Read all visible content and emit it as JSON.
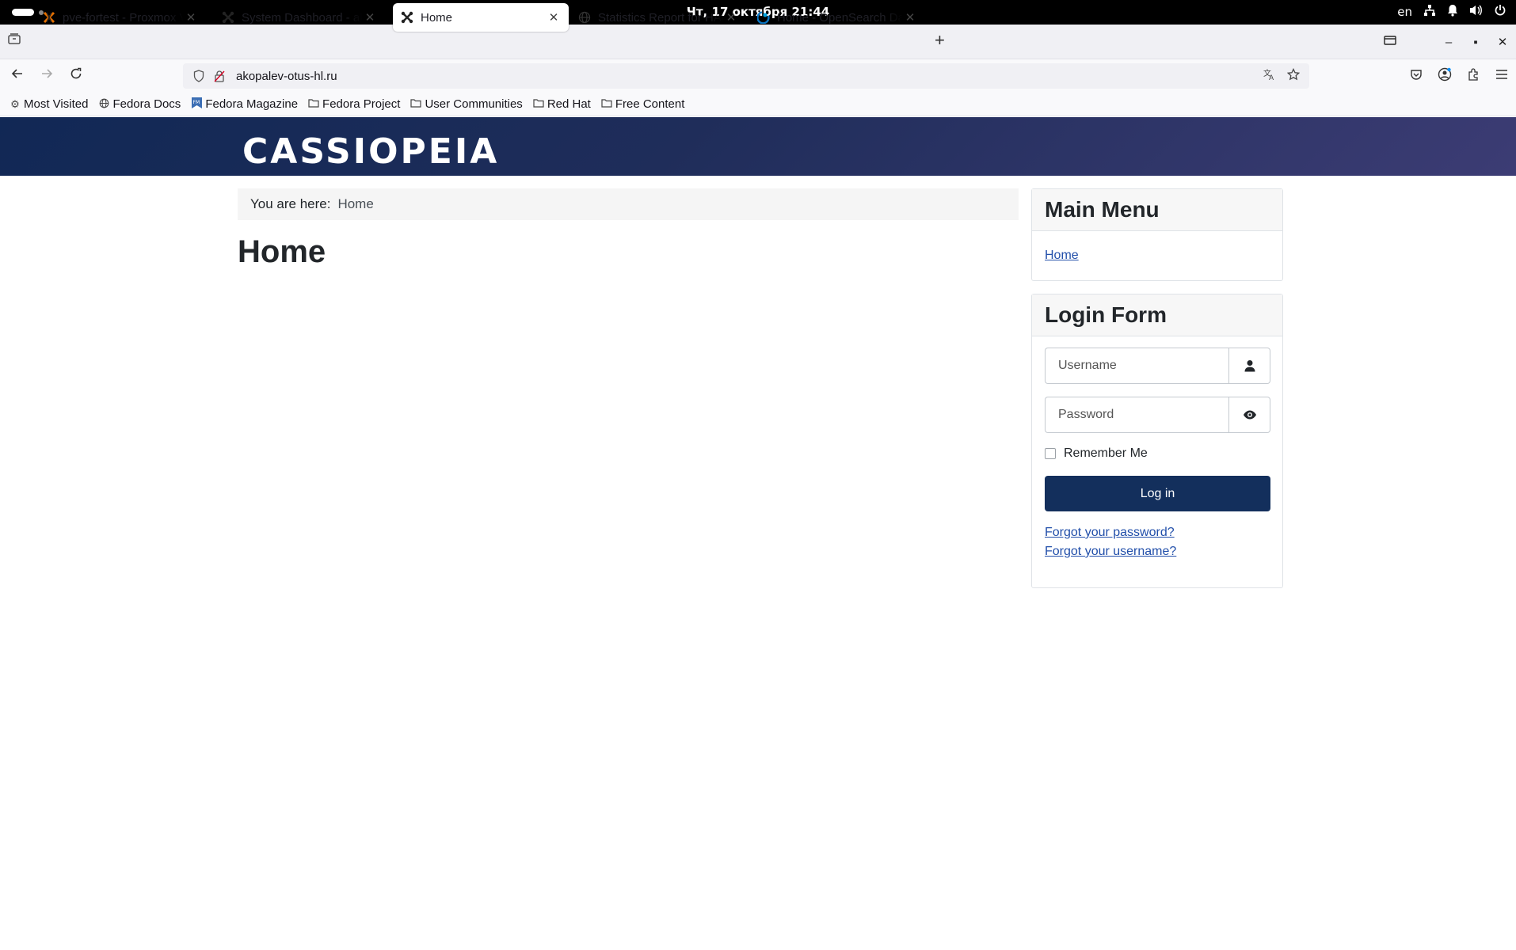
{
  "system": {
    "clock": "Чт, 17 октября  21:44",
    "lang": "en"
  },
  "browser": {
    "tabs": [
      {
        "title": "pve-fortest - Proxmox Virtual Environment",
        "icon": "proxmox-icon"
      },
      {
        "title": "System Dashboard - akopalev-otus-hl.ru",
        "icon": "joomla-icon"
      },
      {
        "title": "Home",
        "icon": "joomla-icon"
      },
      {
        "title": "Statistics Report for HAProxy",
        "icon": "globe-icon"
      },
      {
        "title": "Home - OpenSearch Dashboards",
        "icon": "opensearch-icon"
      }
    ],
    "url": "akopalev-otus-hl.ru",
    "bookmarks": [
      {
        "label": "Most Visited",
        "icon": "gear-icon"
      },
      {
        "label": "Fedora Docs",
        "icon": "globe-icon"
      },
      {
        "label": "Fedora Magazine",
        "icon": "fedora-magazine-icon"
      },
      {
        "label": "Fedora Project",
        "icon": "folder-icon"
      },
      {
        "label": "User Communities",
        "icon": "folder-icon"
      },
      {
        "label": "Red Hat",
        "icon": "folder-icon"
      },
      {
        "label": "Free Content",
        "icon": "folder-icon"
      }
    ]
  },
  "site": {
    "brand": "CASSIOPEIA",
    "breadcrumb_prefix": "You are here:",
    "breadcrumb_item": "Home",
    "page_title": "Home",
    "main_menu": {
      "title": "Main Menu",
      "items": [
        "Home"
      ]
    },
    "login": {
      "title": "Login Form",
      "username_placeholder": "Username",
      "password_placeholder": "Password",
      "remember_label": "Remember Me",
      "button": "Log in",
      "forgot_password": "Forgot your password?",
      "forgot_username": "Forgot your username?"
    }
  },
  "colors": {
    "header_start": "#112855",
    "header_end": "#3c3c74",
    "button": "#132f5c",
    "link": "#224faa"
  }
}
